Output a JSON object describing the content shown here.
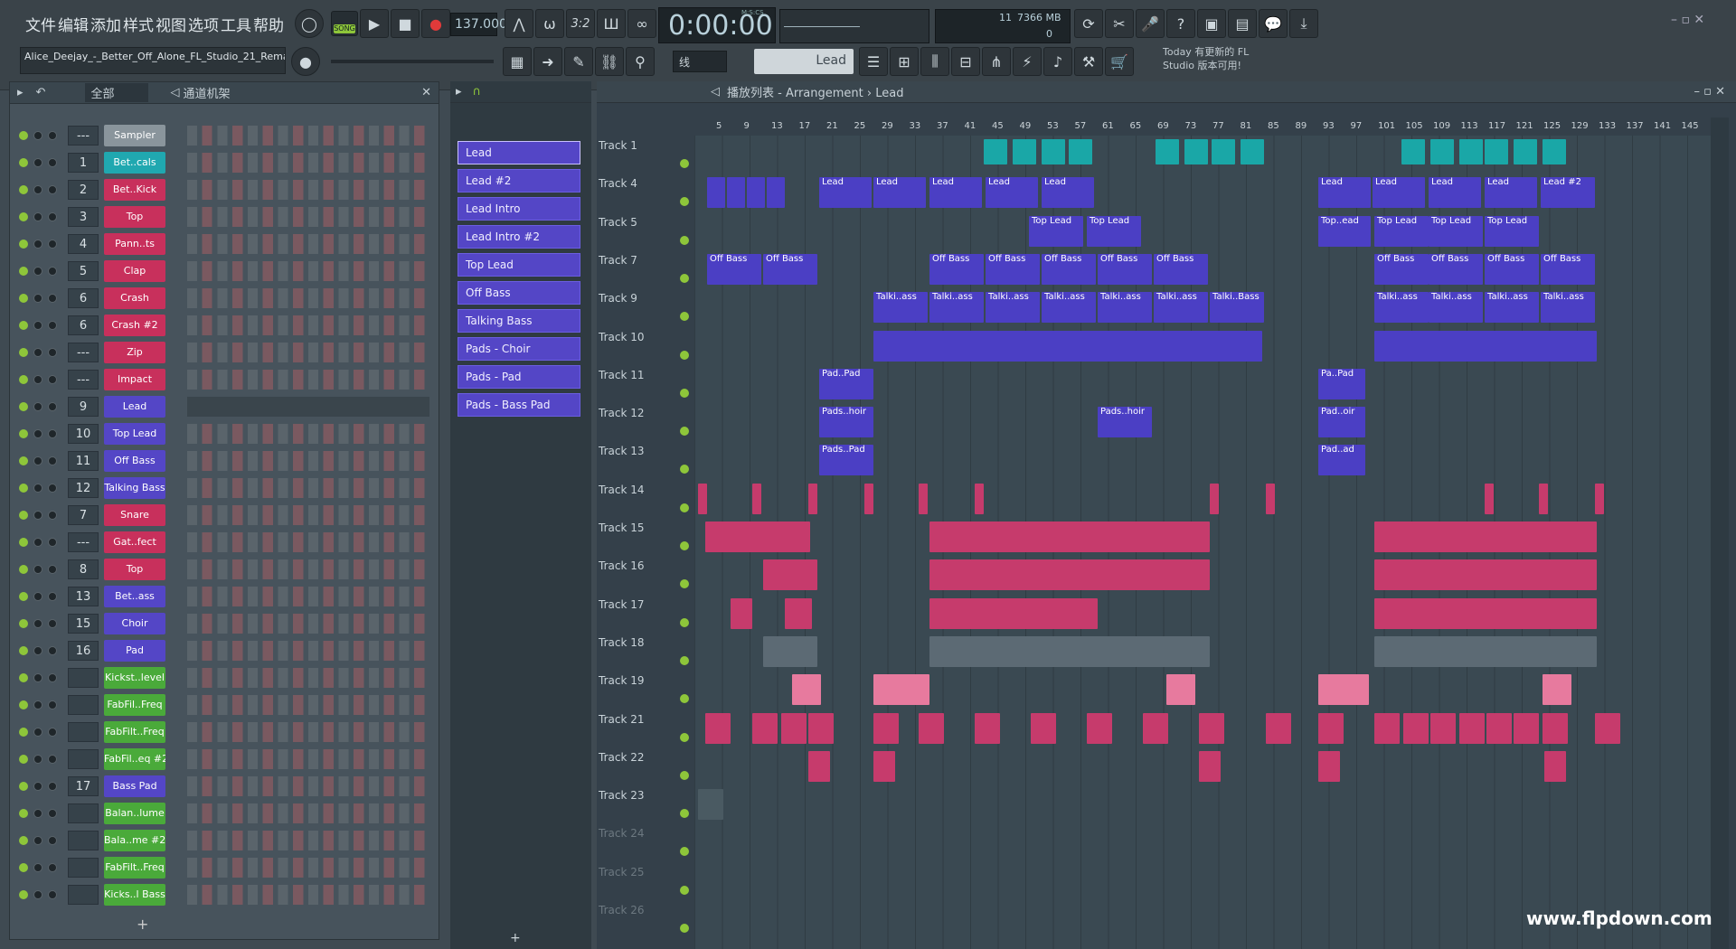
{
  "menu": [
    "文件",
    "编辑",
    "添加",
    "样式",
    "视图",
    "选项",
    "工具",
    "帮助"
  ],
  "transport": {
    "song_label": "SONG",
    "tempo": "137.000",
    "time": "0:00:00",
    "time_unit": "M:S:CS",
    "cpu": "11",
    "mem": "7366 MB",
    "mem2": "0"
  },
  "project_title": "Alice_Deejay_-_Better_Off_Alone_FL_Studio_21_Rema",
  "snap_label": "线",
  "pattern_selector": "Lead",
  "news": {
    "line1": "Today 有更新的 FL",
    "line2": "Studio 版本可用!"
  },
  "channel_rack": {
    "title": "通道机架",
    "filter": "全部",
    "channels": [
      {
        "num": "---",
        "name": "Sampler",
        "color": "#8a959c"
      },
      {
        "num": "1",
        "name": "Bet..cals",
        "color": "#20a8b0"
      },
      {
        "num": "2",
        "name": "Bet..Kick",
        "color": "#c8305c"
      },
      {
        "num": "3",
        "name": "Top",
        "color": "#c8305c"
      },
      {
        "num": "4",
        "name": "Pann..ts",
        "color": "#c8305c"
      },
      {
        "num": "5",
        "name": "Clap",
        "color": "#c8305c"
      },
      {
        "num": "6",
        "name": "Crash",
        "color": "#c8305c"
      },
      {
        "num": "6",
        "name": "Crash #2",
        "color": "#c8305c"
      },
      {
        "num": "---",
        "name": "Zip",
        "color": "#c8305c"
      },
      {
        "num": "---",
        "name": "Impact",
        "color": "#c8305c"
      },
      {
        "num": "9",
        "name": "Lead",
        "color": "#5446c6"
      },
      {
        "num": "10",
        "name": "Top Lead",
        "color": "#5446c6"
      },
      {
        "num": "11",
        "name": "Off Bass",
        "color": "#5446c6"
      },
      {
        "num": "12",
        "name": "Talking Bass",
        "color": "#5446c6"
      },
      {
        "num": "7",
        "name": "Snare",
        "color": "#c8305c"
      },
      {
        "num": "---",
        "name": "Gat..fect",
        "color": "#c8305c"
      },
      {
        "num": "8",
        "name": "Top",
        "color": "#c8305c"
      },
      {
        "num": "13",
        "name": "Bet..ass",
        "color": "#5446c6"
      },
      {
        "num": "15",
        "name": "Choir",
        "color": "#5446c6"
      },
      {
        "num": "16",
        "name": "Pad",
        "color": "#5446c6"
      },
      {
        "num": "",
        "name": "Kickst..level",
        "color": "#4aaa3a"
      },
      {
        "num": "",
        "name": "FabFil..Freq",
        "color": "#4aaa3a"
      },
      {
        "num": "",
        "name": "FabFilt..Freq",
        "color": "#4aaa3a"
      },
      {
        "num": "",
        "name": "FabFil..eq #2",
        "color": "#4aaa3a"
      },
      {
        "num": "17",
        "name": "Bass Pad",
        "color": "#5446c6"
      },
      {
        "num": "",
        "name": "Balan..lume",
        "color": "#4aaa3a"
      },
      {
        "num": "",
        "name": "Bala..me #2",
        "color": "#4aaa3a"
      },
      {
        "num": "",
        "name": "FabFilt..Freq",
        "color": "#4aaa3a"
      },
      {
        "num": "",
        "name": "Kicks..l Bass",
        "color": "#4aaa3a"
      }
    ]
  },
  "patterns": [
    "Lead",
    "Lead #2",
    "Lead Intro",
    "Lead Intro #2",
    "Top Lead",
    "Off Bass",
    "Talking Bass",
    "Pads - Choir",
    "Pads - Pad",
    "Pads - Bass Pad"
  ],
  "playlist": {
    "breadcrumb": "播放列表 - Arrangement › Lead",
    "ruler": [
      "5",
      "9",
      "13",
      "17",
      "21",
      "25",
      "29",
      "33",
      "37",
      "41",
      "45",
      "49",
      "53",
      "57",
      "61",
      "65",
      "69",
      "73",
      "77",
      "81",
      "85",
      "89",
      "93",
      "97",
      "101",
      "105",
      "109",
      "113",
      "117",
      "121",
      "125",
      "129",
      "133",
      "137",
      "141",
      "145"
    ],
    "tracks": [
      "Track 1",
      "Track 4",
      "Track 5",
      "Track 7",
      "Track 9",
      "Track 10",
      "Track 11",
      "Track 12",
      "Track 13",
      "Track 14",
      "Track 15",
      "Track 16",
      "Track 17",
      "Track 18",
      "Track 19",
      "Track 21",
      "Track 22",
      "Track 23",
      "Track 24",
      "Track 25",
      "Track 26"
    ],
    "clips": {
      "lead": "Lead",
      "lead2": "Lead #2",
      "toplead": "Top Lead",
      "topead": "Top..ead",
      "offbass": "Off Bass",
      "talkiass": "Talki..ass",
      "talkibass": "Talki..Bass",
      "padpad": "Pad..Pad",
      "papad": "Pa..Pad",
      "padshoir": "Pads..hoir",
      "padoir": "Pad..oir",
      "padspad": "Pads..Pad",
      "padad": "Pad..ad"
    }
  },
  "watermark": "www.flpdown.com"
}
